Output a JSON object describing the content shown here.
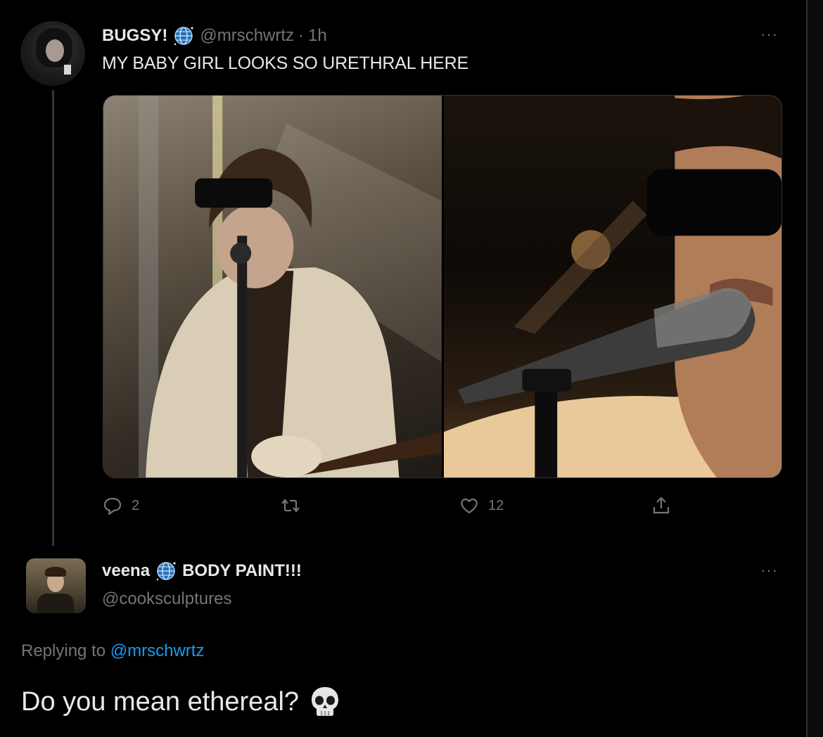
{
  "tweet": {
    "display_name": "BUGSY!",
    "verified_icon": "globe-icon",
    "handle": "@mrschwrtz",
    "separator": "·",
    "time": "1h",
    "text": "MY BABY GIRL LOOKS SO URETHRAL HERE",
    "more_label": "···",
    "media": [
      {
        "alt": "singer in sunglasses and cream suit holding microphone with guitar"
      },
      {
        "alt": "close-up of singer in sunglasses at microphone"
      }
    ],
    "actions": {
      "reply_count": "2",
      "retweet_count": "",
      "like_count": "12",
      "share_count": ""
    }
  },
  "reply": {
    "display_name": "veena",
    "verified_icon": "globe-icon",
    "name_suffix": "BODY PAINT!!!",
    "handle": "@cooksculptures",
    "more_label": "···",
    "replying_prefix": "Replying to",
    "replying_to": "@mrschwrtz",
    "text": "Do you mean ethereal?",
    "emoji_icon": "skull-icon"
  },
  "colors": {
    "background": "#000000",
    "text": "#e7e9ea",
    "muted": "#71767b",
    "link": "#1d9bf0"
  }
}
